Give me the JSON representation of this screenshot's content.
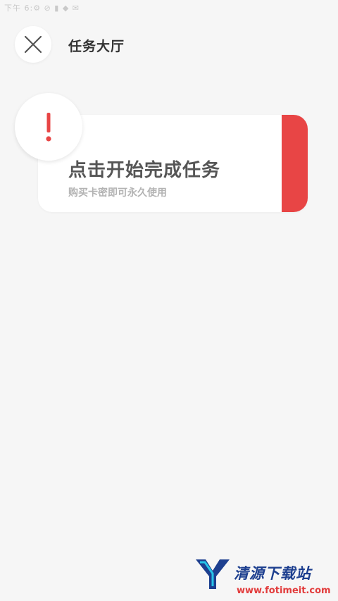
{
  "status_bar": {
    "text": "下午 6:⚙  ⊘ ▮ ◆ ✉"
  },
  "header": {
    "close_icon": "close-icon",
    "title": "任务大厅"
  },
  "task_card": {
    "alert_icon": "exclamation-icon",
    "title": "点击开始完成任务",
    "subtitle": "购买卡密即可永久使用",
    "accent_color": "#e84545"
  },
  "watermark": {
    "logo_icon": "y-logo-icon",
    "title": "清源下载站",
    "url": "www.fotimeit.com"
  }
}
